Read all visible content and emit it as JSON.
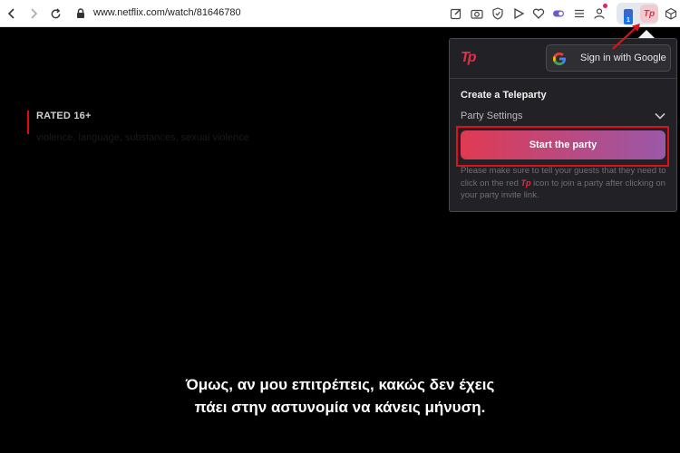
{
  "browser": {
    "url": "www.netflix.com/watch/81646780",
    "extension_badge": "1",
    "teleparty_icon_text": "Tp"
  },
  "video": {
    "rating_title": "RATED 16+",
    "rating_descriptors": "violence, language, substances, sexual violence",
    "subtitle_line1": "Όμως, αν μου επιτρέπεις, κακώς δεν έχεις",
    "subtitle_line2": "πάει στην αστυνομία να κάνεις μήνυση."
  },
  "popup": {
    "logo_text": "Tp",
    "google_button_label": "Sign in with Google",
    "create_title": "Create a Teleparty",
    "settings_label": "Party Settings",
    "start_button_label": "Start the party",
    "note_part1": "Please make sure to tell your guests that they need to click on the red ",
    "note_icon_text": "Tp",
    "note_part2": " icon to join a party after clicking on your party invite link."
  },
  "colors": {
    "teleparty_red": "#e0304a",
    "highlight_red": "#e0101a",
    "gradient_start": "#e03a52",
    "gradient_end": "#9a58a8"
  }
}
